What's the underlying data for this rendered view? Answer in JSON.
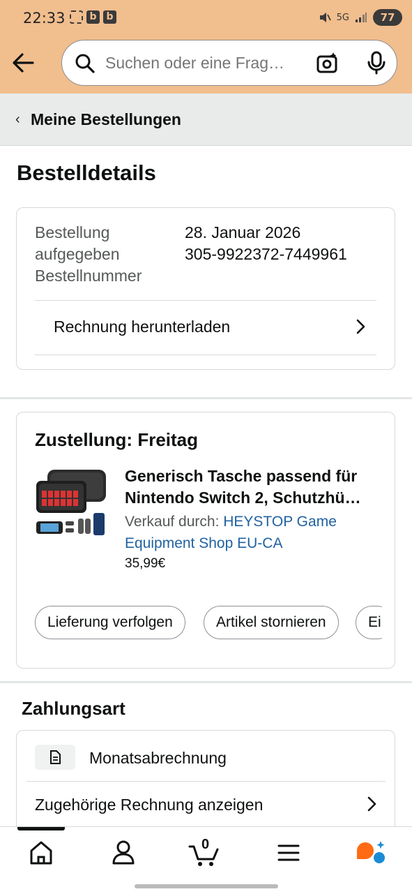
{
  "status_bar": {
    "time": "22:33",
    "battery": "77",
    "network": "5G",
    "app_badges": [
      "b",
      "b"
    ]
  },
  "search": {
    "placeholder": "Suchen oder eine Frag…"
  },
  "breadcrumb": {
    "label": "Meine Bestellungen"
  },
  "page_title": "Bestelldetails",
  "order_info": {
    "placed_label": "Bestellung aufgegeben",
    "number_label": "Bestellnummer",
    "placed_value": "28. Januar 2026",
    "number_value": "305-9922372-7449961",
    "invoice_link": "Rechnung herunterladen"
  },
  "delivery": {
    "heading": "Zustellung: Freitag",
    "product_title_line1": "Generisch Tasche passend für",
    "product_title_line2": "Nintendo Switch 2, Schutzhü…",
    "seller_prefix": "Verkauf durch: ",
    "seller_name": "HEYSTOP Game Equipment Shop EU-CA",
    "price": "35,99€",
    "actions": [
      "Lieferung verfolgen",
      "Artikel stornieren",
      "Ei"
    ]
  },
  "payment": {
    "heading": "Zahlungsart",
    "method": "Monatsabrechnung",
    "invoice_link": "Zugehörige Rechnung anzeigen"
  },
  "bottom_nav": {
    "cart_count": "0",
    "items": [
      "home-icon",
      "account-icon",
      "cart-icon",
      "menu-icon",
      "rufus-icon"
    ]
  },
  "colors": {
    "header_bg": "#f1be8e",
    "link_blue": "#2162a1",
    "rufus_orange": "#ff6a13",
    "rufus_blue": "#1b8bd6"
  }
}
